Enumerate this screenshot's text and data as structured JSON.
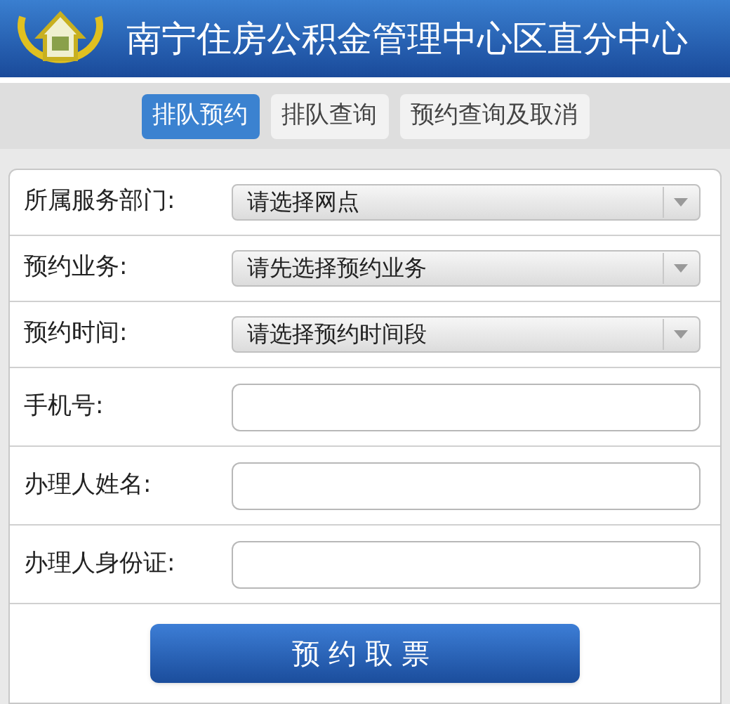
{
  "header": {
    "title": "南宁住房公积金管理中心区直分中心"
  },
  "tabs": [
    {
      "label": "排队预约",
      "selected": true
    },
    {
      "label": "排队查询",
      "selected": false
    },
    {
      "label": "预约查询及取消",
      "selected": false
    }
  ],
  "form": {
    "fields": [
      {
        "kind": "select",
        "label": "所属服务部门:",
        "value": "请选择网点"
      },
      {
        "kind": "select",
        "label": "预约业务:",
        "value": "请先选择预约业务"
      },
      {
        "kind": "select",
        "label": "预约时间:",
        "value": "请选择预约时间段"
      },
      {
        "kind": "input",
        "label": "手机号:"
      },
      {
        "kind": "input",
        "label": "办理人姓名:"
      },
      {
        "kind": "input",
        "label": "办理人身份证:"
      }
    ],
    "submit": "预约取票"
  }
}
